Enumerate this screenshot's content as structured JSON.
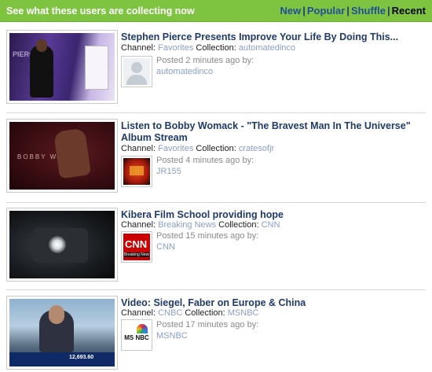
{
  "header": {
    "title": "See what these users are collecting now",
    "nav": [
      {
        "label": "New"
      },
      {
        "label": "Popular"
      },
      {
        "label": "Shuffle"
      },
      {
        "label": "Recent"
      }
    ],
    "separator": "|"
  },
  "labels": {
    "channel": "Channel:",
    "collection": "Collection:"
  },
  "items": [
    {
      "title": "Stephen Pierce Presents Improve Your Life By Doing This...",
      "channel": "Favorites",
      "collection": "automatedinco",
      "posted": "Posted 2 minutes ago by:",
      "user": "automatedinco",
      "thumb_text": "PIERCE"
    },
    {
      "title": "Listen to Bobby Womack - \"The Bravest Man In The Universe\" Album Stream",
      "channel": "Favorites",
      "collection": "cratesofjr",
      "posted": "Posted 4 minutes ago by:",
      "user": "JR155",
      "thumb_text": "BOBBY WOMACK"
    },
    {
      "title": "Kibera Film School providing hope",
      "channel": "Breaking News",
      "collection": "CNN",
      "posted": "Posted 15 minutes ago by:",
      "user": "CNN",
      "avatar_text": "CNN",
      "avatar_subtext": "Breaking News"
    },
    {
      "title": "Video: Siegel, Faber on Europe & China",
      "channel": "CNBC",
      "collection": "MSNBC",
      "posted": "Posted 17 minutes ago by:",
      "user": "MSNBC",
      "avatar_text": "MS NBC",
      "thumb_ticker": "12,693.60"
    }
  ]
}
